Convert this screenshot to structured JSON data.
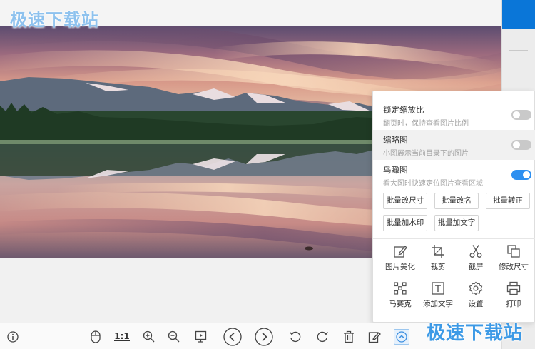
{
  "watermark": {
    "text": "极速下载站"
  },
  "colors": {
    "accent": "#2d8ff0",
    "selected_strip": "#0a76d8"
  },
  "panel": {
    "options": [
      {
        "title": "锁定缩放比",
        "desc": "翻页时，保持查看图片比例",
        "enabled": false
      },
      {
        "title": "缩略图",
        "desc": "小图展示当前目录下的图片",
        "enabled": false
      },
      {
        "title": "鸟瞰图",
        "desc": "看大图时快速定位图片查看区域",
        "enabled": true
      }
    ],
    "batch_buttons": [
      "批量改尺寸",
      "批量改名",
      "批量转正",
      "批量加水印",
      "批量加文字"
    ],
    "tools": [
      {
        "label": "图片美化",
        "icon": "edit-icon"
      },
      {
        "label": "裁剪",
        "icon": "crop-icon"
      },
      {
        "label": "截屏",
        "icon": "scissors-icon"
      },
      {
        "label": "修改尺寸",
        "icon": "resize-icon"
      },
      {
        "label": "马赛克",
        "icon": "mosaic-icon"
      },
      {
        "label": "添加文字",
        "icon": "text-icon"
      },
      {
        "label": "设置",
        "icon": "gear-icon"
      },
      {
        "label": "打印",
        "icon": "printer-icon"
      }
    ]
  },
  "toolbar": {
    "ratio_label": "1:1",
    "icons": [
      "info-icon",
      "mouse-icon",
      "actual-size-icon",
      "zoom-in-icon",
      "zoom-out-icon",
      "slideshow-icon",
      "previous-icon",
      "next-icon",
      "rotate-left-icon",
      "rotate-right-icon",
      "delete-icon",
      "edit-icon",
      "more-icon"
    ]
  }
}
